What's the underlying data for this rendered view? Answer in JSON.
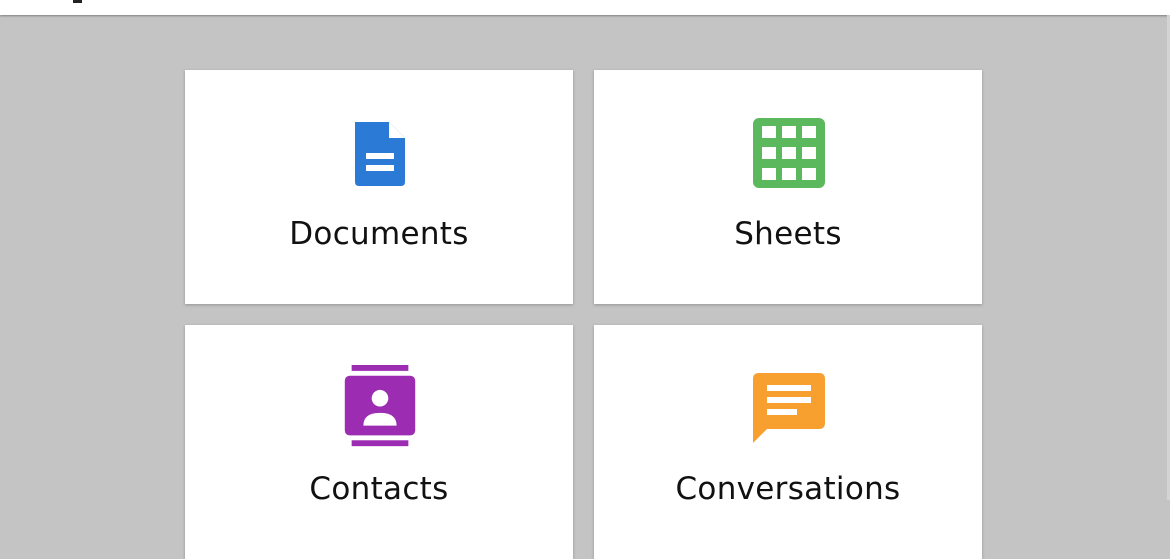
{
  "colors": {
    "background": "#c4c4c4",
    "card": "#ffffff",
    "documents": "#2b7bd6",
    "sheets": "#5cb85c",
    "contacts": "#9c2db3",
    "conversations": "#f7a030"
  },
  "cards": [
    {
      "label": "Documents",
      "icon": "document-icon"
    },
    {
      "label": "Sheets",
      "icon": "spreadsheet-grid-icon"
    },
    {
      "label": "Contacts",
      "icon": "contact-book-icon"
    },
    {
      "label": "Conversations",
      "icon": "chat-bubble-icon"
    }
  ]
}
